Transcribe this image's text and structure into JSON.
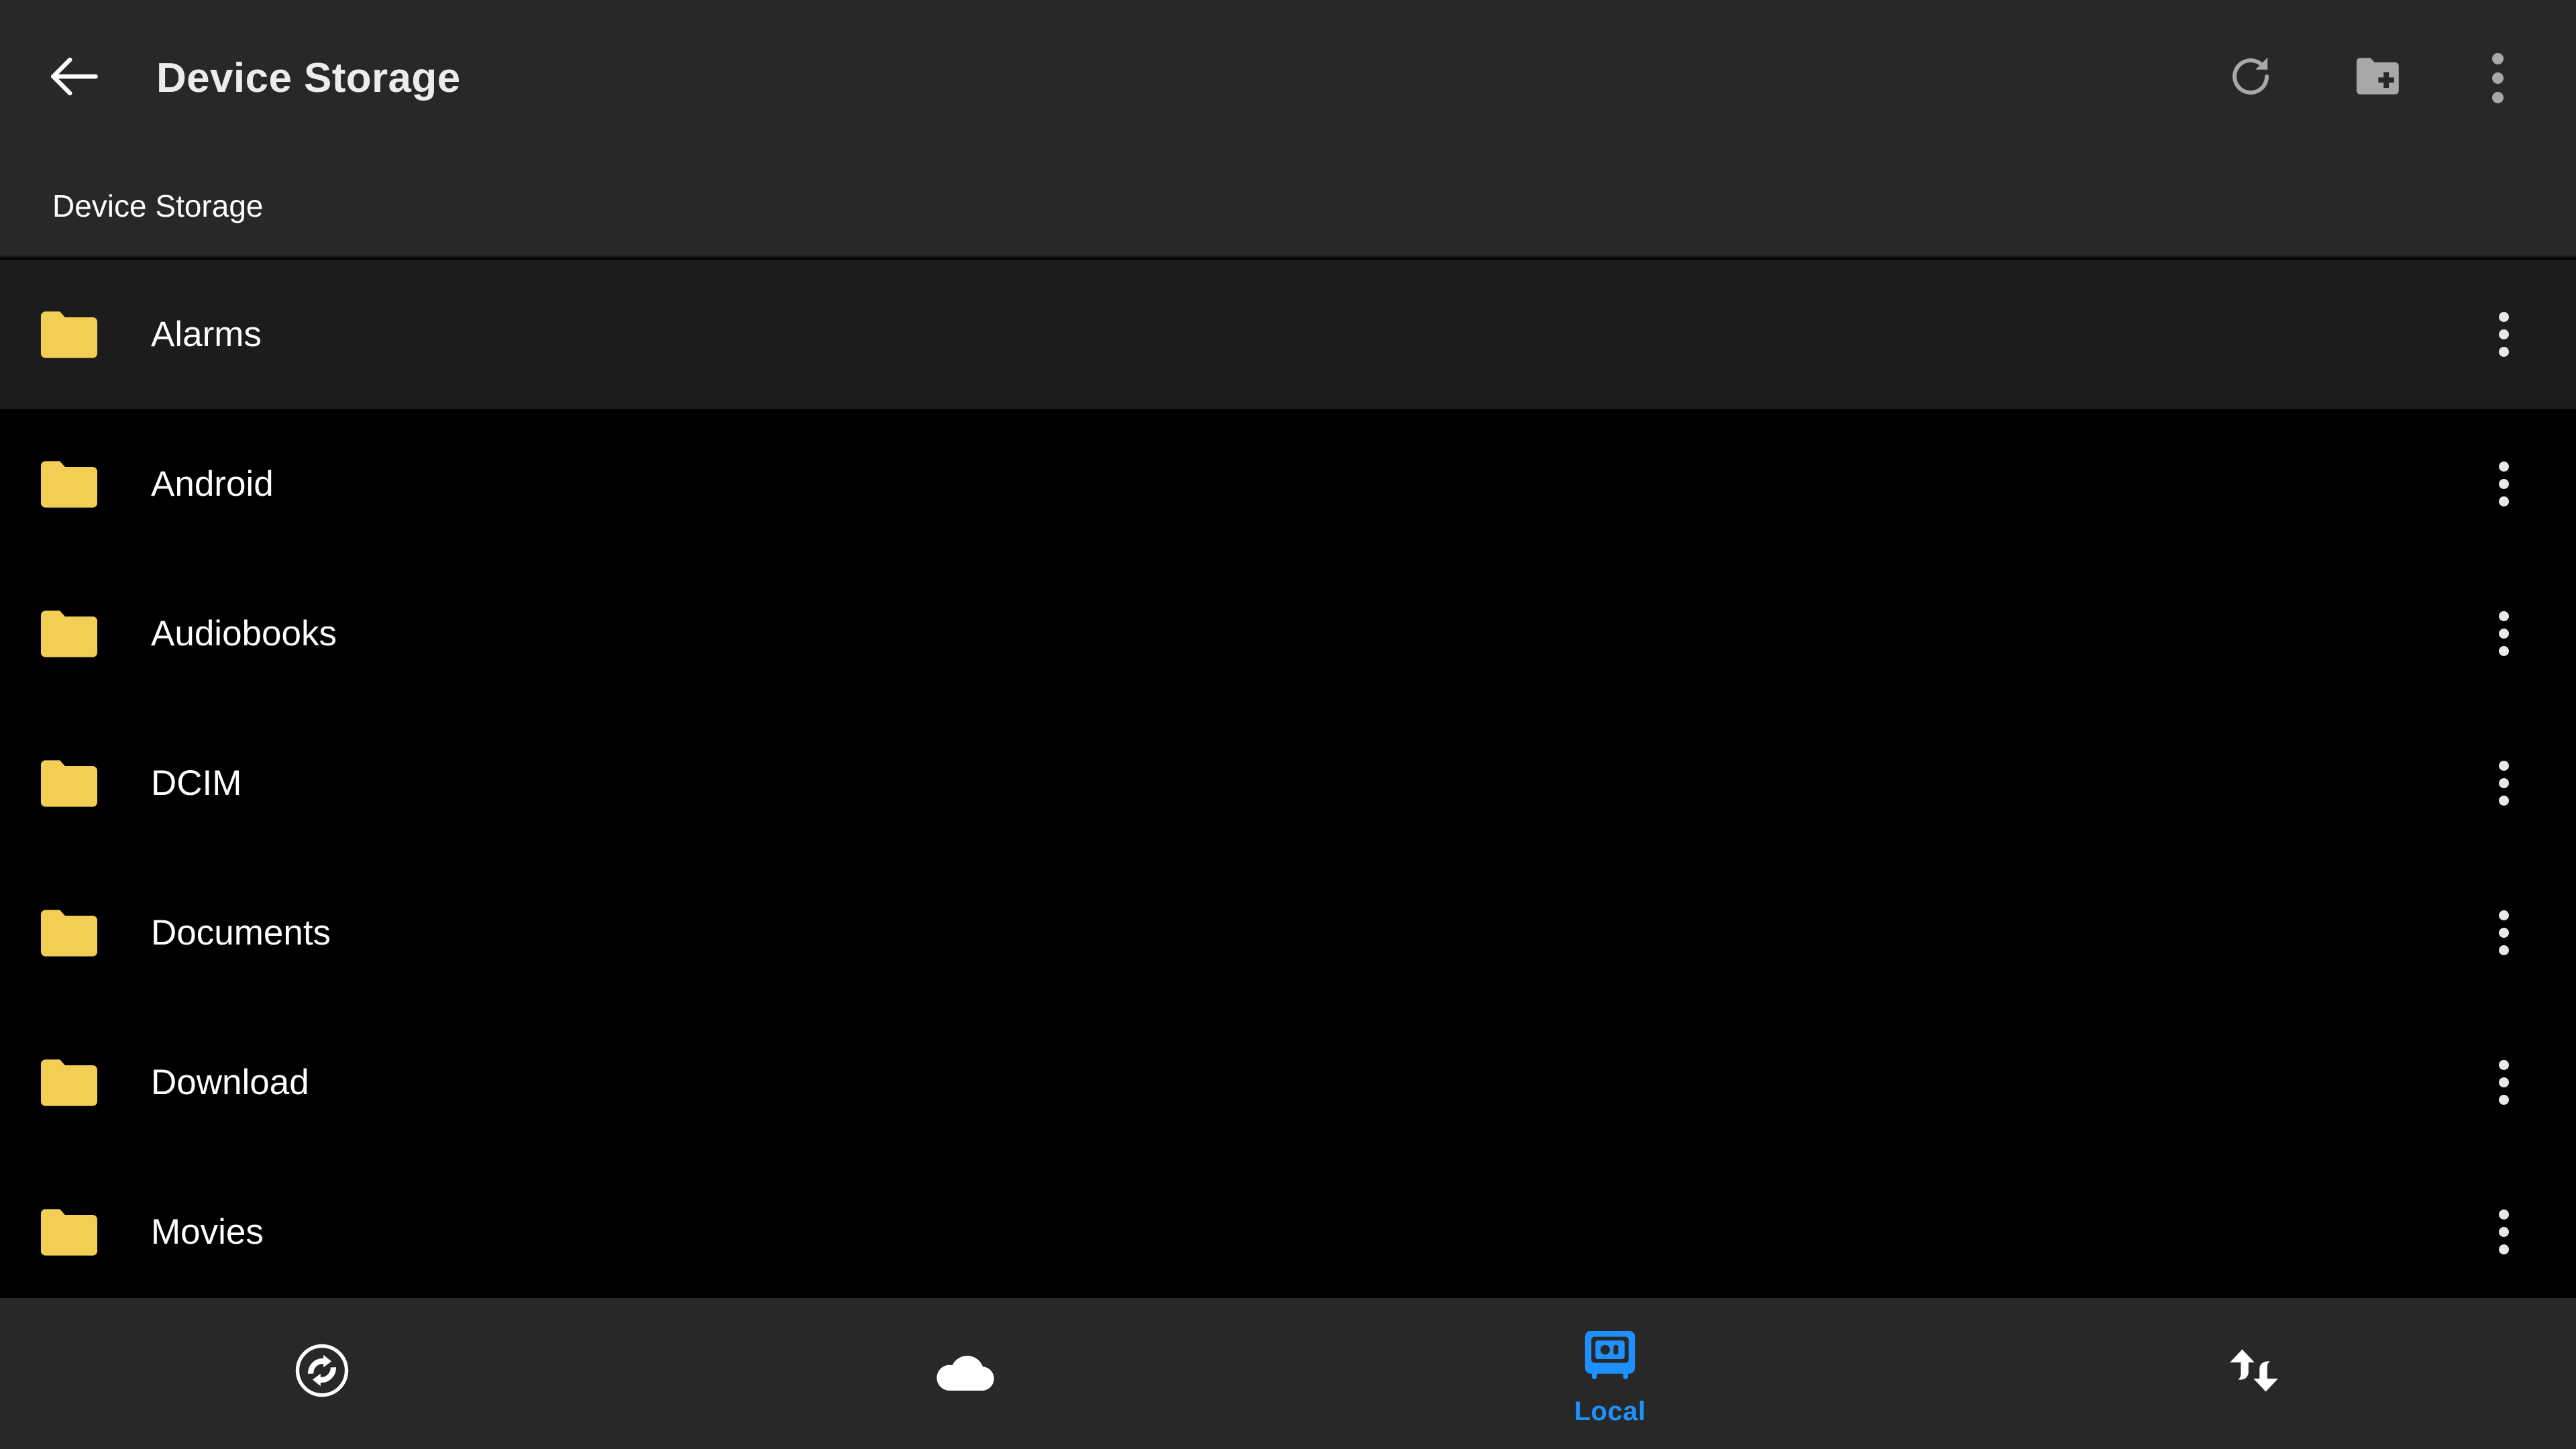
{
  "appbar": {
    "back_icon": "arrow-left-icon",
    "title": "Device Storage",
    "actions": [
      {
        "name": "refresh-button",
        "icon": "refresh-icon",
        "label": "Refresh"
      },
      {
        "name": "new-folder-button",
        "icon": "folder-plus-icon",
        "label": "New Folder"
      },
      {
        "name": "overflow-menu-button",
        "icon": "more-vertical-icon",
        "label": "More options"
      }
    ]
  },
  "breadcrumb": {
    "path": "Device Storage"
  },
  "file_list": {
    "row_menu_icon": "more-vertical-icon",
    "folder_icon": "folder-icon",
    "items": [
      {
        "name": "Alarms",
        "type": "folder",
        "highlighted": true
      },
      {
        "name": "Android",
        "type": "folder",
        "highlighted": false
      },
      {
        "name": "Audiobooks",
        "type": "folder",
        "highlighted": false
      },
      {
        "name": "DCIM",
        "type": "folder",
        "highlighted": false
      },
      {
        "name": "Documents",
        "type": "folder",
        "highlighted": false
      },
      {
        "name": "Download",
        "type": "folder",
        "highlighted": false
      },
      {
        "name": "Movies",
        "type": "folder",
        "highlighted": false
      }
    ]
  },
  "bottom_nav": {
    "items": [
      {
        "icon": "sync-icon",
        "label": "",
        "active": false
      },
      {
        "icon": "cloud-icon",
        "label": "",
        "active": false
      },
      {
        "icon": "safe-icon",
        "label": "Local",
        "active": true
      },
      {
        "icon": "transfer-icon",
        "label": "",
        "active": false
      }
    ]
  },
  "colors": {
    "accent": "#1e90ff",
    "folder": "#f2ce55",
    "appbar_bg": "#282828",
    "list_bg": "#000000",
    "row_highlight_bg": "#1c1c1c",
    "icon_grey": "#a8a8a8"
  }
}
